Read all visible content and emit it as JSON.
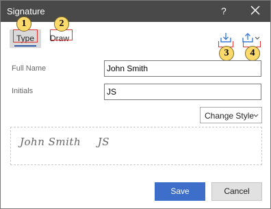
{
  "window": {
    "title": "Signature",
    "help": "?"
  },
  "tabs": [
    {
      "label": "Type",
      "badge": "1"
    },
    {
      "label": "Draw",
      "badge": "2"
    }
  ],
  "toolbar": {
    "save_badge": "3",
    "load_badge": "4"
  },
  "form": {
    "full_name_label": "Full Name",
    "full_name_value": "John Smith",
    "initials_label": "Initials",
    "initials_value": "JS"
  },
  "change_style_label": "Change Style",
  "preview": {
    "name": "John Smith",
    "initials": "JS"
  },
  "actions": {
    "save_label": "Save",
    "cancel_label": "Cancel"
  },
  "colors": {
    "titlebar": "#494949",
    "accent": "#3d6ec9",
    "tab_underline": "#2e5aa8",
    "annotation_red": "#e03030",
    "badge_fill": "#fbd96b"
  },
  "icons": {
    "close": "close-icon",
    "save_signature": "download-tray-icon",
    "load_signature": "upload-tray-icon",
    "dropdown": "chevron-down-icon"
  }
}
